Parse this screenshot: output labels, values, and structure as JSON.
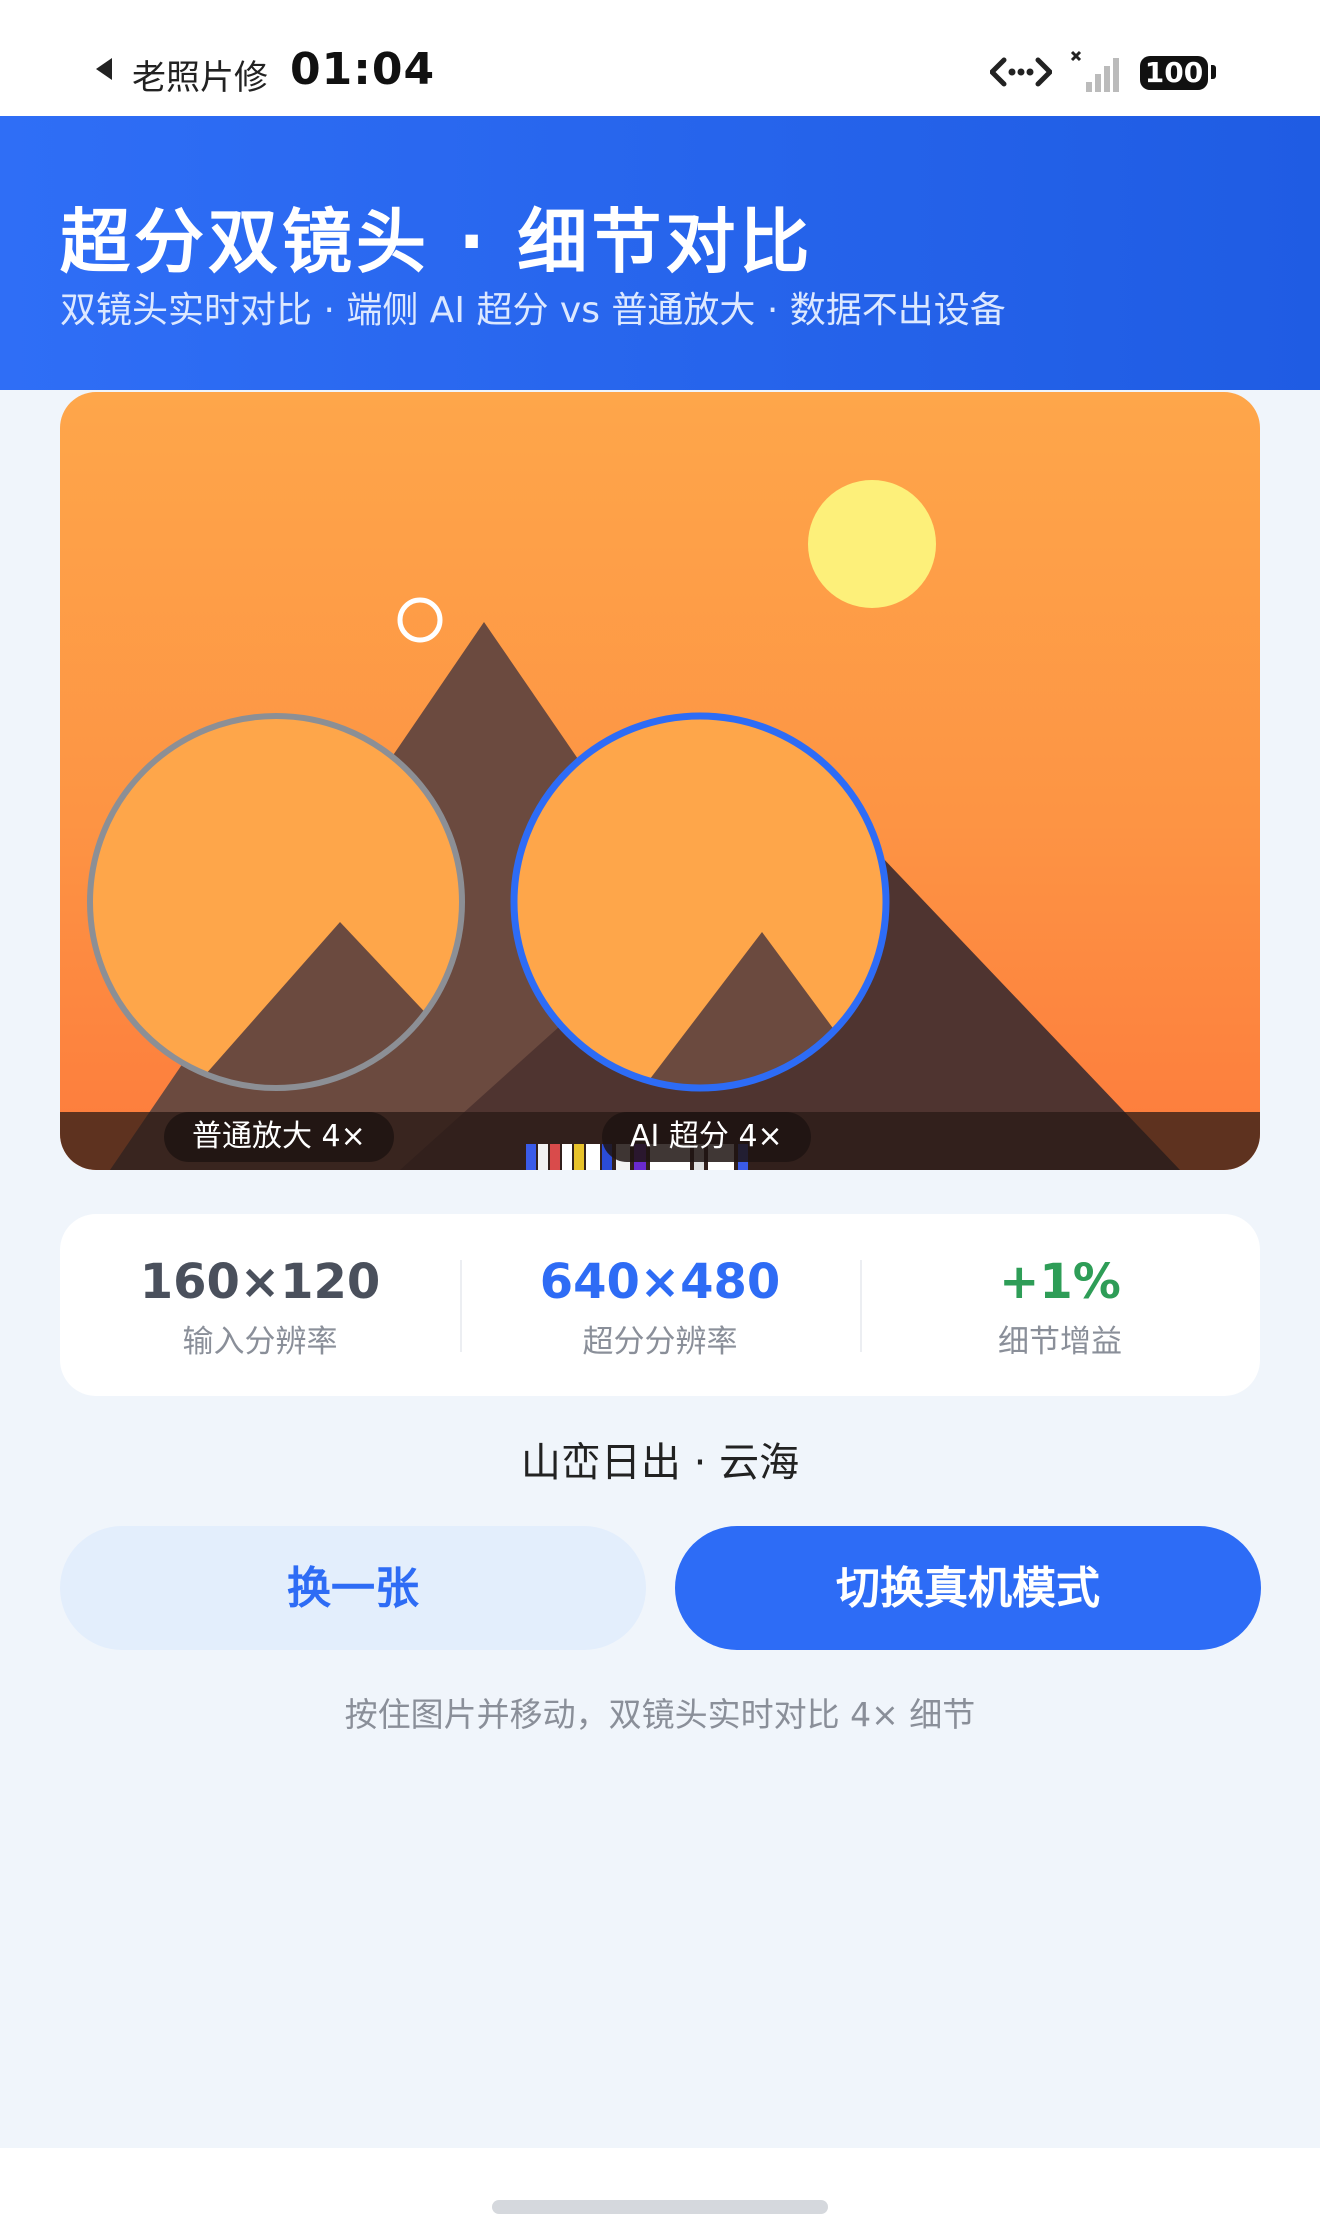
{
  "status_bar": {
    "back_app": "老照片修",
    "time": "01:04",
    "battery": "100"
  },
  "header": {
    "title": "超分双镜头 · 细节对比",
    "subtitle": "双镜头实时对比 · 端侧 AI 超分 vs 普通放大 · 数据不出设备"
  },
  "preview": {
    "lens_normal_label": "普通放大 4×",
    "lens_ai_label": "AI 超分 4×"
  },
  "stats": [
    {
      "value": "160×120",
      "label": "输入分辨率",
      "color": "#4a505c"
    },
    {
      "value": "640×480",
      "label": "超分分辨率",
      "color": "#2e6cf5"
    },
    {
      "value": "+1%",
      "label": "细节增益",
      "color": "#2e9d57"
    }
  ],
  "caption": "山峦日出 · 云海",
  "buttons": {
    "change_image": "换一张",
    "switch_mode": "切换真机模式"
  },
  "hint": "按住图片并移动，双镜头实时对比 4× 细节",
  "colors": {
    "accent": "#2d6cf6",
    "sun": "#fdf07a",
    "mountain": "#6b4a3f",
    "mountain_dark": "#4f3430"
  }
}
